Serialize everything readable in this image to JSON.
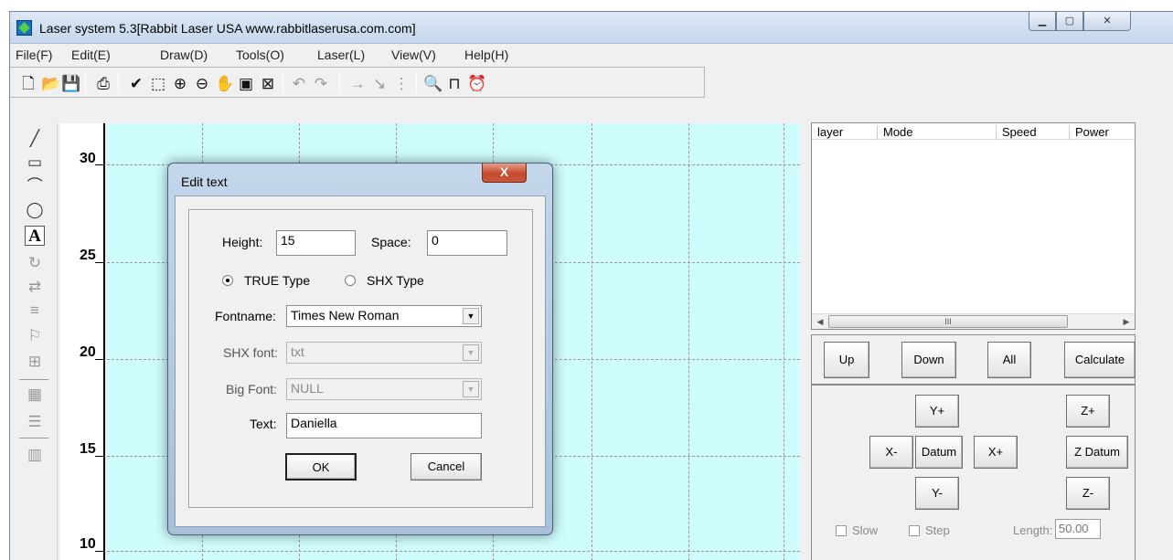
{
  "window": {
    "title": "Laser system 5.3[Rabbit Laser USA www.rabbitlaserusa.com.com]"
  },
  "menu": [
    "File(F)",
    "Edit(E)",
    "Draw(D)",
    "Tools(O)",
    "Laser(L)",
    "View(V)",
    "Help(H)"
  ],
  "toolbar_icons": [
    "new-file-icon",
    "open-folder-icon",
    "save-icon",
    "import-icon",
    "select-icon",
    "node-edit-icon",
    "zoom-in-icon",
    "zoom-out-icon",
    "pan-hand-icon",
    "zoom-page-icon",
    "zoom-fit-icon",
    "undo-icon",
    "redo-icon",
    "cut-direction-icon",
    "cut-order-icon",
    "array-icon",
    "preview-icon",
    "machine-settings-icon",
    "timer-icon"
  ],
  "left_tools": [
    "line-icon",
    "rectangle-icon",
    "polyline-icon",
    "ellipse-icon",
    "text-icon",
    "rotate-icon",
    "mirror-icon",
    "align-icon",
    "node-icon",
    "group-icon",
    "array-tool-icon",
    "layer-order-icon",
    "bitmap-icon"
  ],
  "ruler": {
    "labels": [
      "30",
      "25",
      "20",
      "15",
      "10"
    ]
  },
  "layer_table": {
    "columns": [
      "layer",
      "Mode",
      "Speed",
      "Power"
    ],
    "scroll_thumb": "III"
  },
  "layer_buttons": {
    "up": "Up",
    "down": "Down",
    "all": "All",
    "calculate": "Calculate"
  },
  "motion": {
    "y_plus": "Y+",
    "y_minus": "Y-",
    "x_minus": "X-",
    "x_plus": "X+",
    "datum": "Datum",
    "z_plus": "Z+",
    "z_datum": "Z Datum",
    "z_minus": "Z-"
  },
  "options": {
    "slow": "Slow",
    "step": "Step",
    "length_label": "Length:",
    "length_value": "50.00"
  },
  "dialog": {
    "title": "Edit text",
    "close_label": "X",
    "height_label": "Height:",
    "height_value": "15",
    "space_label": "Space:",
    "space_value": "0",
    "true_type_label": "TRUE Type",
    "shx_type_label": "SHX Type",
    "selected_type": "TRUE Type",
    "fontname_label": "Fontname:",
    "fontname_value": "Times New Roman",
    "shx_font_label": "SHX font:",
    "shx_font_value": "txt",
    "big_font_label": "Big Font:",
    "big_font_value": "NULL",
    "text_label": "Text:",
    "text_value": "Daniella",
    "ok_label": "OK",
    "cancel_label": "Cancel"
  }
}
